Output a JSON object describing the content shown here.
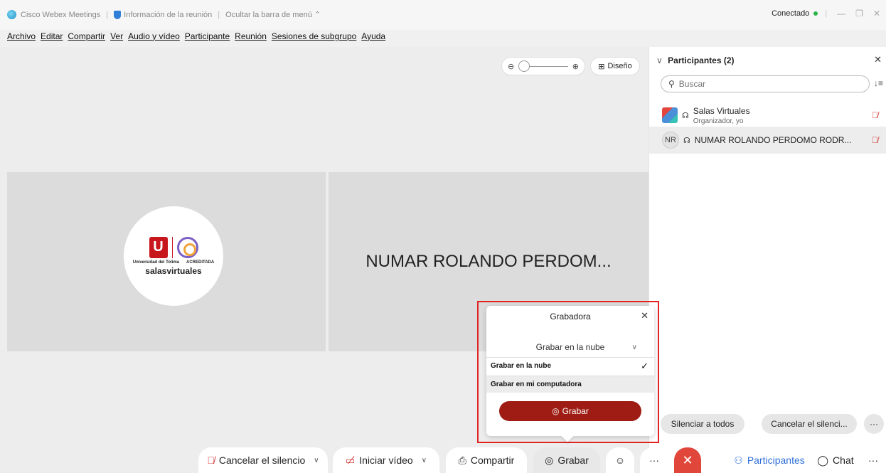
{
  "titlebar": {
    "app_name": "Cisco Webex Meetings",
    "meeting_info": "Información de la reunión",
    "hide_menu": "Ocultar la barra de menú ⌃",
    "status": "Conectado",
    "status_color": "#2bb34a"
  },
  "menu": [
    "Archivo",
    "Editar",
    "Compartir",
    "Ver",
    "Audio y vídeo",
    "Participante",
    "Reunión",
    "Sesiones de subgrupo",
    "Ayuda"
  ],
  "stage": {
    "layout_label": "Diseño",
    "video_name": "NUMAR ROLANDO PERDOM...",
    "logo_left": "Universidad del Tolima",
    "logo_right": "ACREDITADA",
    "brand": "salasvirtuales"
  },
  "participants": {
    "header": "Participantes (2)",
    "search_placeholder": "Buscar",
    "list": [
      {
        "name": "Salas Virtuales",
        "role": "Organizador, yo",
        "initials": ""
      },
      {
        "name": "NUMAR ROLANDO PERDOMO RODR...",
        "role": "",
        "initials": "NR"
      }
    ],
    "mute_all": "Silenciar a todos",
    "unmute_all": "Cancelar el silenci...",
    "more": "···"
  },
  "recorder": {
    "title": "Grabadora",
    "selected": "Grabar en la nube",
    "options": [
      "Grabar en la nube",
      "Grabar en mi computadora"
    ],
    "record_button": "Grabar",
    "accent": "#9e1c13"
  },
  "controls": {
    "unmute": "Cancelar el silencio",
    "video": "Iniciar vídeo",
    "share": "Compartir",
    "record": "Grabar",
    "more": "···",
    "participants": "Participantes",
    "chat": "Chat",
    "more2": "···"
  }
}
